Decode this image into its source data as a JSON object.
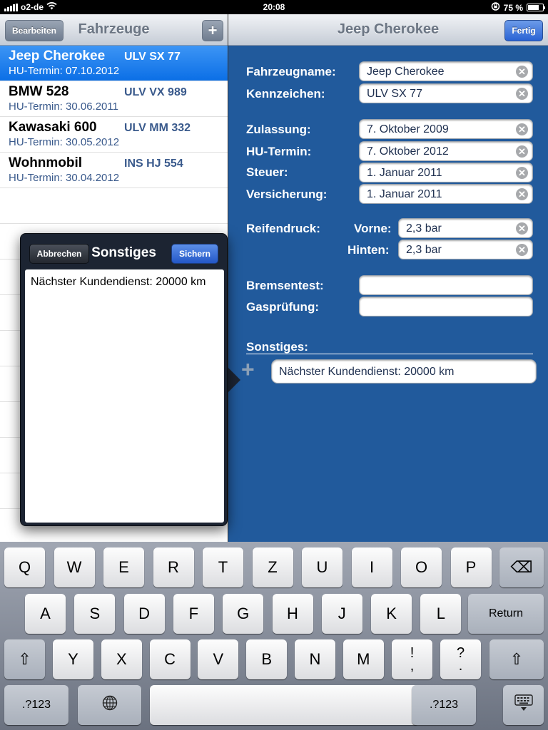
{
  "status_bar": {
    "carrier": "o2-de",
    "time": "20:08",
    "battery": "75 %",
    "battery_level": 0.75
  },
  "master": {
    "title": "Fahrzeuge",
    "edit_label": "Bearbeiten",
    "add_label": "+",
    "vehicles": [
      {
        "name": "Jeep Cherokee",
        "plate": "ULV SX 77",
        "hu_label": "HU-Termin:",
        "hu_date": "07.10.2012",
        "selected": true
      },
      {
        "name": "BMW 528",
        "plate": "ULV VX 989",
        "hu_label": "HU-Termin:",
        "hu_date": "30.06.2011",
        "selected": false
      },
      {
        "name": "Kawasaki 600",
        "plate": "ULV MM 332",
        "hu_label": "HU-Termin:",
        "hu_date": "30.05.2012",
        "selected": false
      },
      {
        "name": "Wohnmobil",
        "plate": "INS HJ 554",
        "hu_label": "HU-Termin:",
        "hu_date": "30.04.2012",
        "selected": false
      }
    ]
  },
  "detail": {
    "title": "Jeep Cherokee",
    "done_label": "Fertig",
    "labels": {
      "name": "Fahrzeugname:",
      "plate": "Kennzeichen:",
      "registration": "Zulassung:",
      "hu": "HU-Termin:",
      "tax": "Steuer:",
      "insurance": "Versicherung:",
      "tire_pressure": "Reifendruck:",
      "front": "Vorne:",
      "rear": "Hinten:",
      "brake_test": "Bremsentest:",
      "gas_test": "Gasprüfung:",
      "misc": "Sonstiges:"
    },
    "values": {
      "name": "Jeep Cherokee",
      "plate": "ULV SX 77",
      "registration": "7. Oktober 2009",
      "hu": "7. Oktober 2012",
      "tax": "1. Januar 2011",
      "insurance": "1. Januar 2011",
      "front": "2,3 bar",
      "rear": "2,3 bar",
      "brake_test": "",
      "gas_test": "",
      "misc": "Nächster Kundendienst: 20000 km"
    },
    "add_icon": "+",
    "clear_icon": "✕"
  },
  "popover": {
    "title": "Sonstiges",
    "cancel_label": "Abbrechen",
    "save_label": "Sichern",
    "text": "Nächster Kundendienst: 20000 km"
  },
  "keyboard": {
    "row1": [
      "Q",
      "W",
      "E",
      "R",
      "T",
      "Z",
      "U",
      "I",
      "O",
      "P"
    ],
    "row2": [
      "A",
      "S",
      "D",
      "F",
      "G",
      "H",
      "J",
      "K",
      "L"
    ],
    "row3": [
      "Y",
      "X",
      "C",
      "V",
      "B",
      "N",
      "M"
    ],
    "return_label": "Return",
    "numbers_label": ".?123",
    "backspace_icon": "⌫",
    "shift_icon": "⇧",
    "globe_icon": "🌐",
    "hide_keyboard_icon": "⌨",
    "punct1_top": "!",
    "punct1_bottom": ",",
    "punct2_top": "?",
    "punct2_bottom": "."
  }
}
